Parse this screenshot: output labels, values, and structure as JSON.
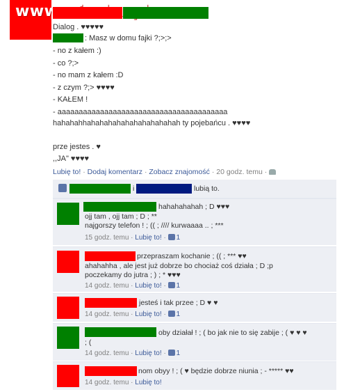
{
  "watermark": "www.wiocha.pl",
  "colors": {
    "link": "#3b5998",
    "comment_bg": "#edeff4",
    "redact_red": "#ff0000",
    "redact_green": "#008000",
    "redact_blue": "#001a80"
  },
  "post": {
    "lines": [
      "Dialog . ♥♥♥♥♥",
      ": Masz w domu fajki ?;>;>",
      "- no z kałem :)",
      "- co ?;>",
      "- no mam z kałem :D",
      "- z czym ?;> ♥♥♥♥",
      "- KAŁEM !",
      "- aaaaaaaaaaaaaaaaaaaaaaaaaaaaaaaaaaaaaaaa",
      "hahahahhahahahahahahahahahahah ty pojebańcu . ♥♥♥♥",
      "prze jestes . ♥",
      ",,JA\" ♥♥♥♥"
    ],
    "actions": {
      "like": "Lubię to!",
      "sep1": "·",
      "comment": "Dodaj komentarz",
      "sep2": "·",
      "friendship": "Zobacz znajomość",
      "sep3": "·",
      "time": "20 godz. temu",
      "sep4": "·"
    }
  },
  "likes_bar": {
    "and": "i",
    "suffix": "lubią to."
  },
  "comments": [
    {
      "lines": [
        "hahahahahah ; D ♥♥♥",
        "ojj tam , ojj tam ; D ; **",
        "najgorszy telefon ! ; (( ; //// kurwaaaa .. ; ***"
      ],
      "time": "15 godz. temu",
      "like": "Lubię to!",
      "likes": "1"
    },
    {
      "lines": [
        "przepraszam kochanie ; (( ; *** ♥♥",
        "ahahahha , ale jest już dobrze bo chociaż coś działa ; D ;p",
        "poczekamy do jutra ; ) ; * ♥♥♥"
      ],
      "time": "14 godz. temu",
      "like": "Lubię to!",
      "likes": "1"
    },
    {
      "lines": [
        "jesteś i tak przee ; D ♥ ♥"
      ],
      "time": "14 godz. temu",
      "like": "Lubię to!",
      "likes": "1"
    },
    {
      "lines": [
        "oby działał ! ; ( bo jak nie to się zabije ; ( ♥ ♥ ♥",
        "; ("
      ],
      "time": "14 godz. temu",
      "like": "Lubię to!",
      "likes": "1"
    },
    {
      "lines": [
        "nom obyy ! ; ( ♥ będzie dobrze niunia ; - ***** ♥♥"
      ],
      "time": "14 godz. temu",
      "like": "Lubię to!"
    }
  ],
  "sep": "·"
}
